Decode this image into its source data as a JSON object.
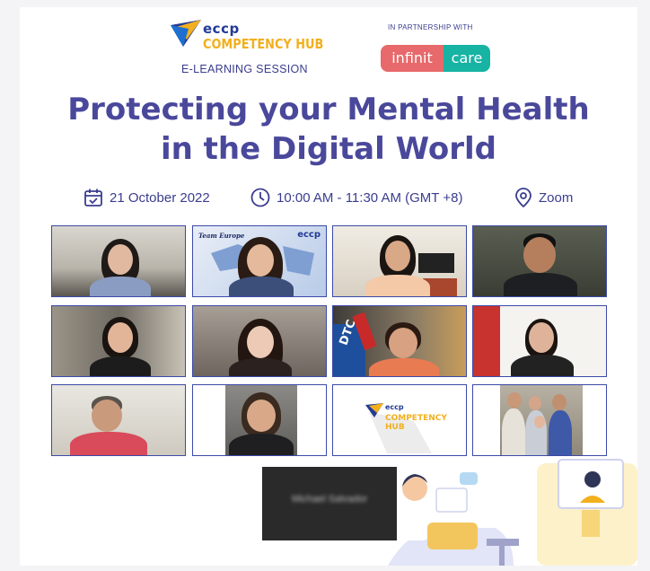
{
  "header": {
    "eccp_logo_text": "eccp",
    "hub_logo_text": "COMPETENCY HUB",
    "subtitle": "E-LEARNING SESSION",
    "partnership_label": "IN PARTNERSHIP WITH",
    "partner_logo_left": "infinit",
    "partner_logo_right": "care"
  },
  "title": {
    "line1": "Protecting your Mental Health",
    "line2": "in the Digital World"
  },
  "event": {
    "date": "21 October 2022",
    "time": "10:00 AM - 11:30 AM (GMT +8)",
    "location": "Zoom"
  },
  "participant_grid": {
    "team_europe_label": "Team Europe",
    "team_europe_logo": "eccp",
    "hub_tile_eccp": "eccp",
    "hub_tile_label": "COMPETENCY HUB",
    "dtc_sign": "DTC",
    "blurred_name": "Michael Salvador"
  },
  "colors": {
    "title": "#4a489b",
    "accent_navy": "#223a96",
    "accent_gold": "#f2b01e",
    "partner_coral": "#e7696b",
    "partner_teal": "#17b3a3",
    "tile_border": "#3b4aa8"
  },
  "icons": [
    "calendar-icon",
    "clock-icon",
    "location-pin-icon"
  ]
}
